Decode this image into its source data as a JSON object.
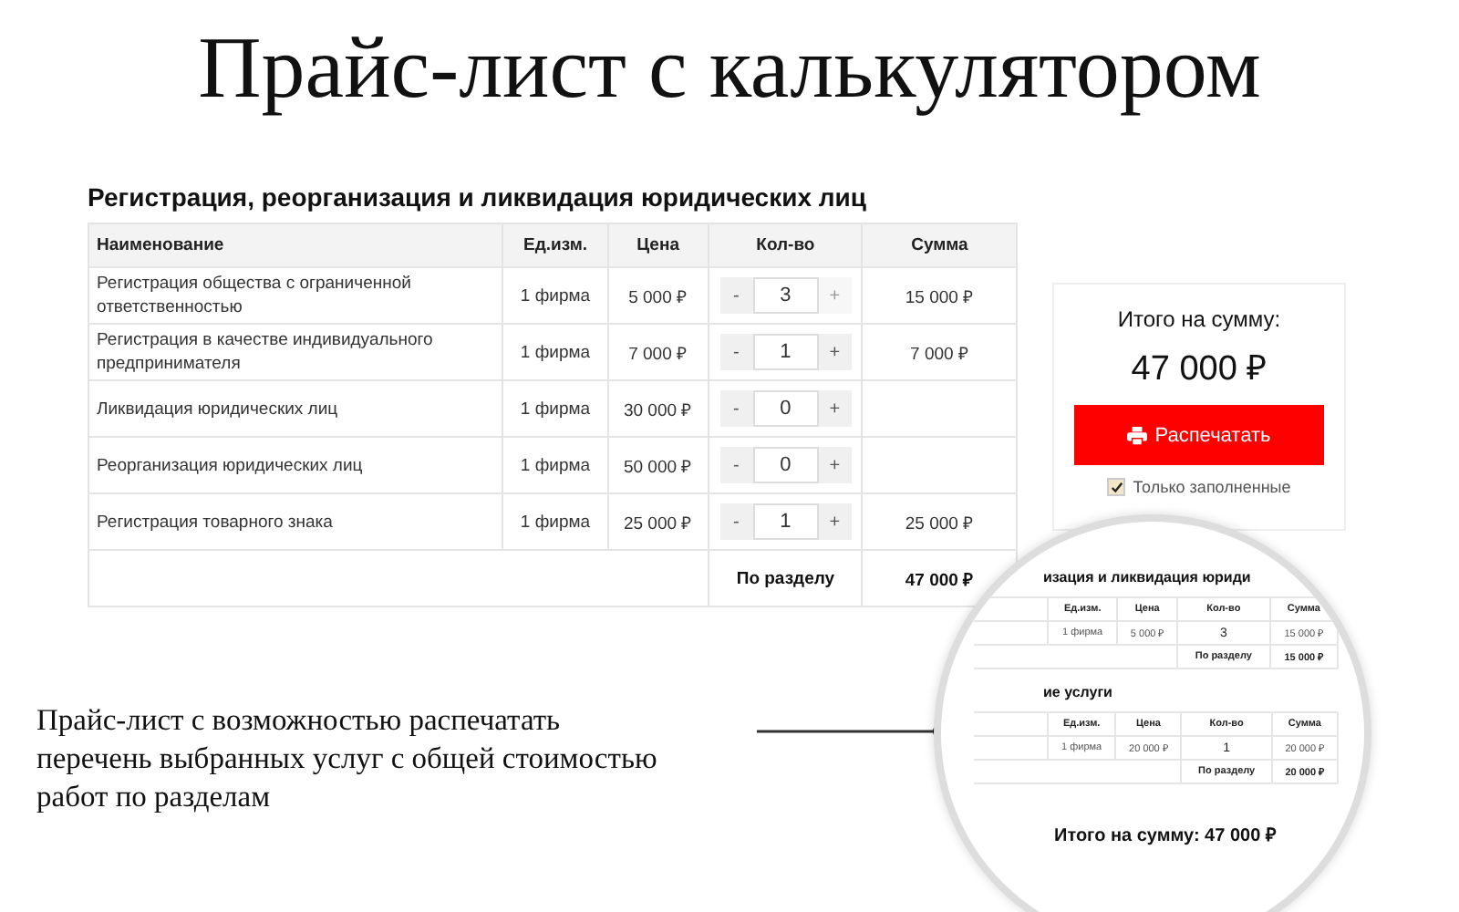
{
  "title": "Прайс-лист с калькулятором",
  "section": {
    "heading": "Регистрация, реорганизация и ликвидация юридических лиц",
    "columns": [
      "Наименование",
      "Ед.изм.",
      "Цена",
      "Кол-во",
      "Сумма"
    ],
    "rows": [
      {
        "name": "Регистрация общества с ограниченной ответственностью",
        "unit": "1 фирма",
        "price": "5 000 ₽",
        "minus": "-",
        "qty": "3",
        "plus": "+",
        "plus_disabled": true,
        "sum": "15 000 ₽"
      },
      {
        "name": "Регистрация в качестве индивидуального предпринимателя",
        "unit": "1 фирма",
        "price": "7 000 ₽",
        "minus": "-",
        "qty": "1",
        "plus": "+",
        "plus_disabled": false,
        "sum": "7 000 ₽"
      },
      {
        "name": "Ликвидация юридических лиц",
        "unit": "1 фирма",
        "price": "30 000 ₽",
        "minus": "-",
        "qty": "0",
        "plus": "+",
        "plus_disabled": false
      },
      {
        "name": "Реорганизация юридических лиц",
        "unit": "1 фирма",
        "price": "50 000 ₽",
        "minus": "-",
        "qty": "0",
        "plus": "+",
        "plus_disabled": false
      },
      {
        "name": "Регистрация товарного знака",
        "unit": "1 фирма",
        "price": "25 000 ₽",
        "minus": "-",
        "qty": "1",
        "plus": "+",
        "plus_disabled": false,
        "sum": "25 000 ₽"
      }
    ],
    "footer": {
      "label": "По разделу",
      "total": "47 000 ₽"
    }
  },
  "summary": {
    "label": "Итого на сумму:",
    "total": "47 000 ₽",
    "print_button": "Распечатать",
    "only_filled": {
      "label": "Только заполненные",
      "checked": true
    }
  },
  "caption": "Прайс-лист с возможностью распечатать перечень выбранных услуг с общей стоимостью работ по разделам",
  "preview": {
    "sections": [
      {
        "heading": "изация и ликвидация юриди",
        "columns": [
          "Ед.изм.",
          "Цена",
          "Кол-во",
          "Сумма"
        ],
        "rows": [
          [
            "1 фирма",
            "5 000 ₽",
            "3",
            "15 000 ₽"
          ]
        ],
        "footer": {
          "label": "По разделу",
          "total": "15 000 ₽"
        }
      },
      {
        "heading": "ие услуги",
        "columns": [
          "Ед.изм.",
          "Цена",
          "Кол-во",
          "Сумма"
        ],
        "rows": [
          [
            "1 фирма",
            "20 000 ₽",
            "1",
            "20 000 ₽"
          ]
        ],
        "footer": {
          "label": "По разделу",
          "total": "20 000 ₽"
        }
      }
    ],
    "total": "Итого на сумму: 47 000 ₽"
  }
}
